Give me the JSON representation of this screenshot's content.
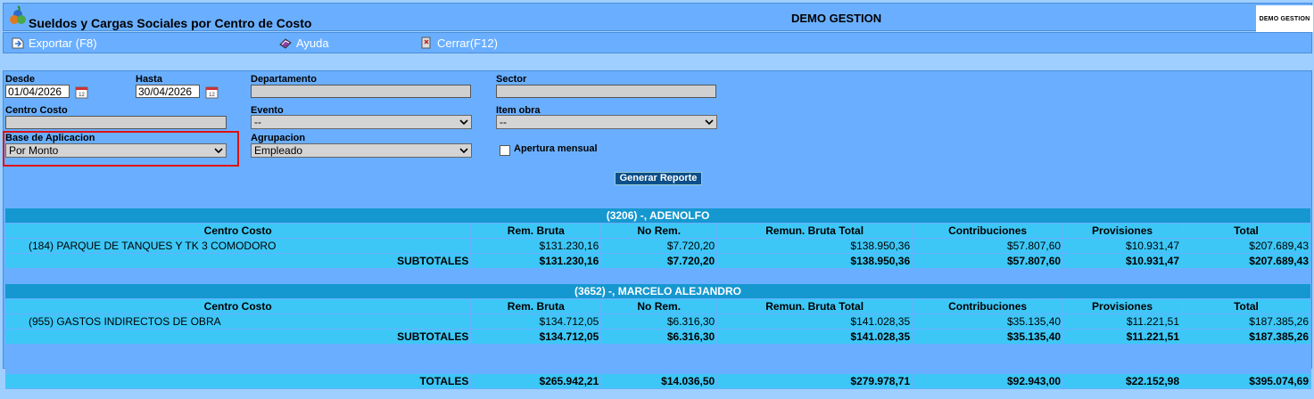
{
  "window": {
    "title": "Sueldos y Cargas Sociales por Centro de Costo",
    "company": "DEMO GESTION",
    "brand_logo_text": "DEMO GESTION"
  },
  "toolbar": {
    "export_label": "Exportar (F8)",
    "help_label": "Ayuda",
    "close_label": "Cerrar(F12)"
  },
  "filters": {
    "desde_label": "Desde",
    "desde_value": "01/04/2026",
    "hasta_label": "Hasta",
    "hasta_value": "30/04/2026",
    "departamento_label": "Departamento",
    "departamento_value": "",
    "sector_label": "Sector",
    "sector_value": "",
    "centro_costo_label": "Centro Costo",
    "centro_costo_value": "",
    "evento_label": "Evento",
    "evento_value": "--",
    "item_obra_label": "Item obra",
    "item_obra_value": "--",
    "base_label": "Base de Aplicacion",
    "base_value": "Por Monto",
    "agrupacion_label": "Agrupacion",
    "agrupacion_value": "Empleado",
    "apertura_label": "Apertura mensual",
    "generar_label": "Generar Reporte"
  },
  "report": {
    "columns": [
      "Centro Costo",
      "Rem. Bruta",
      "No Rem.",
      "Remun. Bruta Total",
      "Contribuciones",
      "Provisiones",
      "Total"
    ],
    "groups": [
      {
        "title": "(3206) -, ADENOLFO",
        "rows": [
          [
            "(184) PARQUE DE TANQUES Y TK 3 COMODORO",
            "$131.230,16",
            "$7.720,20",
            "$138.950,36",
            "$57.807,60",
            "$10.931,47",
            "$207.689,43"
          ]
        ],
        "subtotal": [
          "SUBTOTALES",
          "$131.230,16",
          "$7.720,20",
          "$138.950,36",
          "$57.807,60",
          "$10.931,47",
          "$207.689,43"
        ]
      },
      {
        "title": "(3652) -, MARCELO ALEJANDRO",
        "rows": [
          [
            "(955) GASTOS INDIRECTOS DE OBRA",
            "$134.712,05",
            "$6.316,30",
            "$141.028,35",
            "$35.135,40",
            "$11.221,51",
            "$187.385,26"
          ]
        ],
        "subtotal": [
          "SUBTOTALES",
          "$134.712,05",
          "$6.316,30",
          "$141.028,35",
          "$35.135,40",
          "$11.221,51",
          "$187.385,26"
        ]
      }
    ],
    "totals": [
      "TOTALES",
      "$265.942,21",
      "$14.036,50",
      "$279.978,71",
      "$92.943,00",
      "$22.152,98",
      "$395.074,69"
    ]
  }
}
